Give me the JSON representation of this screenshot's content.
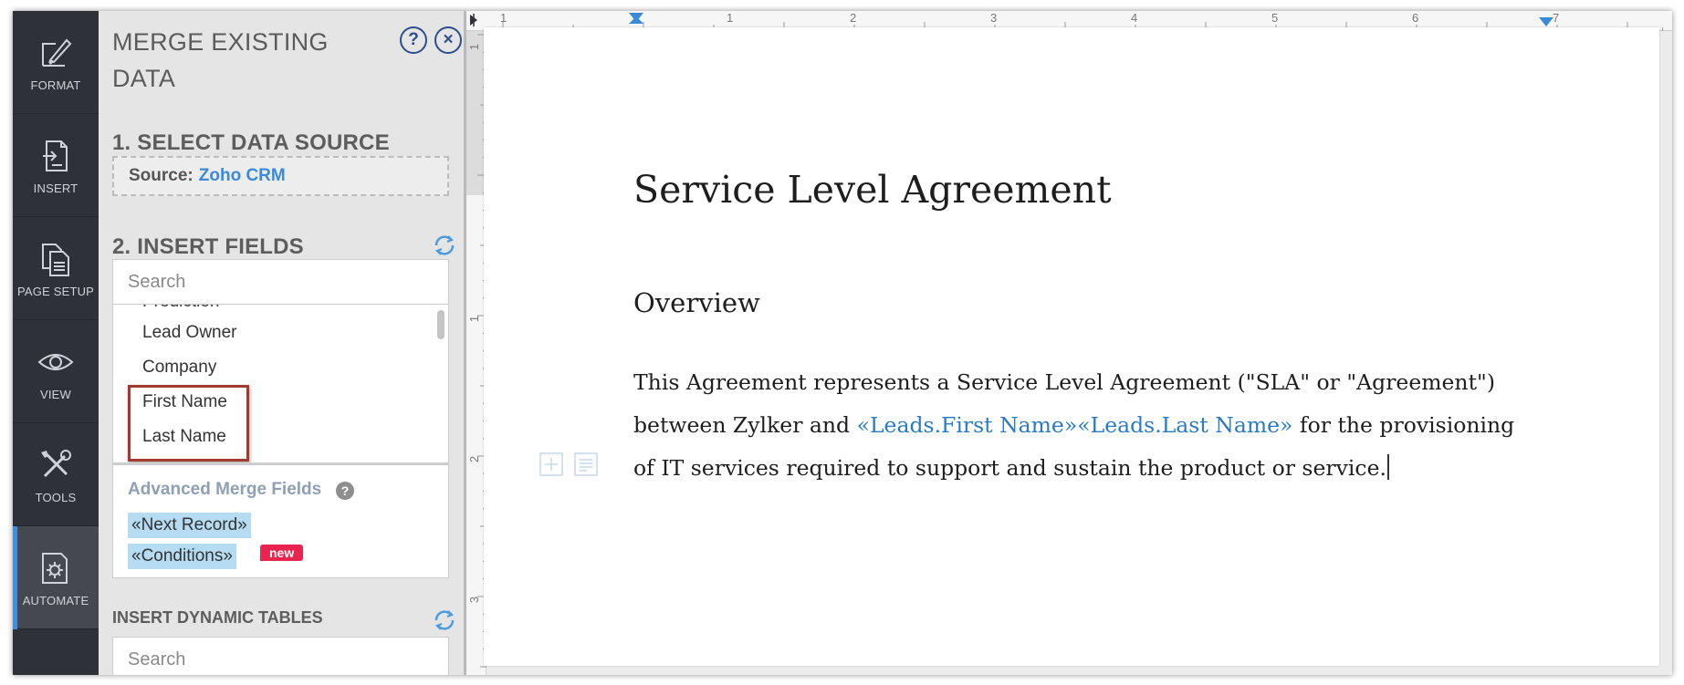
{
  "rail": {
    "items": [
      {
        "label": "FORMAT",
        "icon": "format-brush-icon"
      },
      {
        "label": "INSERT",
        "icon": "insert-document-icon"
      },
      {
        "label": "PAGE SETUP",
        "icon": "page-setup-icon"
      },
      {
        "label": "VIEW",
        "icon": "eye-icon"
      },
      {
        "label": "TOOLS",
        "icon": "tools-icon"
      },
      {
        "label": "AUTOMATE",
        "icon": "automate-gear-icon"
      }
    ],
    "active": "AUTOMATE"
  },
  "panel": {
    "title_line1": "MERGE EXISTING",
    "title_line2": "DATA",
    "help_label": "?",
    "close_label": "×",
    "section1": "1. SELECT DATA SOURCE",
    "source_label": "Source:",
    "source_value": "Zoho CRM",
    "section2": "2. INSERT FIELDS",
    "search_placeholder": "Search",
    "fields": [
      "Prediction",
      "Lead Owner",
      "Company",
      "First Name",
      "Last Name"
    ],
    "advanced_title": "Advanced Merge Fields",
    "advanced_help": "?",
    "chips": [
      "«Next Record»",
      "«Conditions»"
    ],
    "new_badge": "new",
    "section3": "INSERT DYNAMIC TABLES",
    "search2_placeholder": "Search"
  },
  "ruler": {
    "h_numbers": [
      "1",
      "1",
      "2",
      "3",
      "4",
      "5",
      "6",
      "7"
    ],
    "v_numbers": [
      "1",
      "1",
      "2",
      "3"
    ]
  },
  "document": {
    "title": "Service Level Agreement",
    "heading": "Overview",
    "line1": "This Agreement represents a Service Level Agreement (\"SLA\" or \"Agreement\")",
    "line2_pre": "between Zylker and ",
    "field1": "«Leads.First Name»",
    "field2": "«Leads.Last Name»",
    "line2_post": " for the provisioning",
    "line3": "of IT services required to support and sustain the product or service."
  },
  "colors": {
    "rail_bg": "#2e3238",
    "accent": "#3d8fe0",
    "merge_field": "#2a7bc4",
    "highlight_border": "#a33a2f",
    "new_badge": "#e8244f",
    "chip_bg": "#b5dcf2"
  }
}
